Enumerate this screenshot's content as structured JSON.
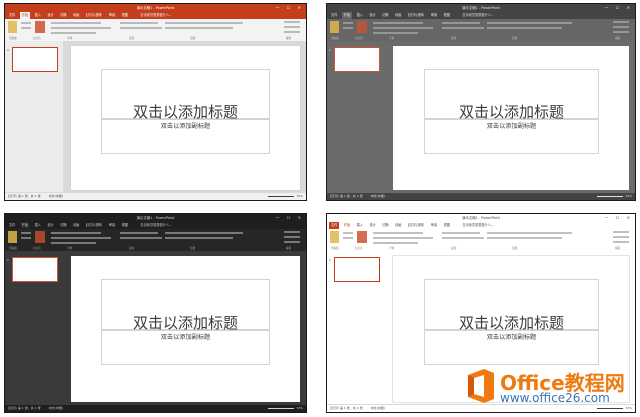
{
  "window_title": "演示文稿1 - PowerPoint",
  "slide_title": "双击以添加标题",
  "slide_subtitle": "双击以添加副标题",
  "slide_number": "1",
  "status_left": "幻灯片 第 1 张，共 1 张",
  "status_lang": "中文(中国)",
  "zoom": "72%",
  "tabs": [
    "文件",
    "开始",
    "插入",
    "设计",
    "切换",
    "动画",
    "幻灯片放映",
    "审阅",
    "视图"
  ],
  "tell_me": "告诉我您想要做什么...",
  "ribbon_groups": [
    "剪贴板",
    "幻灯片",
    "字体",
    "段落",
    "绘图",
    "编辑"
  ],
  "window_controls": "—  ☐  ✕",
  "watermark": {
    "brand": "Office教程网",
    "site": "www.office26.com"
  },
  "themes": [
    {
      "name": "colorful",
      "accent": "#c43e1c",
      "titlebar": "#c43e1c",
      "tabs_bg": "#c43e1c",
      "ribbon": "#f3f3f3",
      "pane": "#ececec",
      "canvas": "#d9d9d9",
      "status": "#f0f0f0",
      "text_on_bar": "#ffffff",
      "text": "#444444"
    },
    {
      "name": "dark-gray",
      "accent": "#d35230",
      "titlebar": "#444444",
      "tabs_bg": "#444444",
      "ribbon": "#666666",
      "pane": "#6b6b6b",
      "canvas": "#6b6b6b",
      "status": "#444444",
      "text_on_bar": "#e6e6e6",
      "text": "#e0e0e0"
    },
    {
      "name": "black",
      "accent": "#d35230",
      "titlebar": "#1f1f1f",
      "tabs_bg": "#1f1f1f",
      "ribbon": "#262626",
      "pane": "#3a3a3a",
      "canvas": "#3a3a3a",
      "status": "#1f1f1f",
      "text_on_bar": "#d0d0d0",
      "text": "#d0d0d0"
    },
    {
      "name": "white",
      "accent": "#c43e1c",
      "titlebar": "#ffffff",
      "tabs_bg": "#ffffff",
      "ribbon": "#ffffff",
      "pane": "#ffffff",
      "canvas": "#ffffff",
      "status": "#ffffff",
      "text_on_bar": "#444444",
      "text": "#444444"
    }
  ]
}
